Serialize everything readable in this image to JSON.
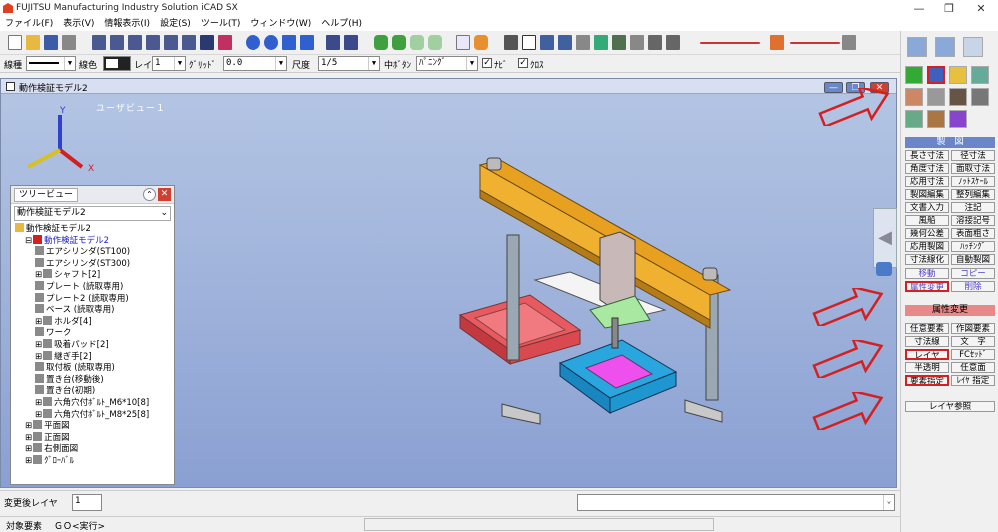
{
  "app": {
    "title": "FUJITSU Manufacturing Industry Solution iCAD SX"
  },
  "window_controls": {
    "minimize": "—",
    "restore": "❐",
    "close": "✕"
  },
  "menu": [
    "ファイル(F)",
    "表示(V)",
    "情報表示(I)",
    "設定(S)",
    "ツール(T)",
    "ウィンドウ(W)",
    "ヘルプ(H)"
  ],
  "toolbar2": {
    "line_type_label": "線種",
    "line_color_label": "線色",
    "layer_label": "レイヤ",
    "layer_value": "1",
    "grid_label": "ｸﾞﾘｯﾄﾞ",
    "grid_value": "0.0",
    "scale_label": "尺度",
    "scale_value": "1/5",
    "center_btn_label": "中ﾎﾞﾀﾝ",
    "center_btn_value": "ﾊﾟﾆﾝｸﾞ",
    "check1_label": "ﾅﾋﾞ",
    "check2_label": "ｸﾛｽ",
    "check1_mark": "✓",
    "check2_mark": "✓"
  },
  "viewport": {
    "title": "動作検証モデル2",
    "view_label": "ユーザビュー１",
    "axis_x": "X",
    "axis_y": "Y"
  },
  "tree": {
    "tab": "ツリービュー",
    "select": "動作検証モデル2",
    "items": [
      {
        "label": "動作検証モデル2",
        "level": 0,
        "exp": ""
      },
      {
        "label": "動作検証モデル2",
        "level": 1,
        "exp": "⊟",
        "red": true
      },
      {
        "label": "エアシリンダ(ST100)",
        "level": 2,
        "exp": ""
      },
      {
        "label": "エアシリンダ(ST300)",
        "level": 2,
        "exp": ""
      },
      {
        "label": "シャフト[2]",
        "level": 2,
        "exp": "⊞"
      },
      {
        "label": "プレート (読取専用)",
        "level": 2,
        "exp": ""
      },
      {
        "label": "プレート2 (読取専用)",
        "level": 2,
        "exp": ""
      },
      {
        "label": "ベース (読取専用)",
        "level": 2,
        "exp": ""
      },
      {
        "label": "ホルダ[4]",
        "level": 2,
        "exp": "⊞"
      },
      {
        "label": "ワーク",
        "level": 2,
        "exp": ""
      },
      {
        "label": "吸着パッド[2]",
        "level": 2,
        "exp": "⊞"
      },
      {
        "label": "継ぎ手[2]",
        "level": 2,
        "exp": "⊞"
      },
      {
        "label": "取付板 (読取専用)",
        "level": 2,
        "exp": ""
      },
      {
        "label": "置き台(移動後)",
        "level": 2,
        "exp": ""
      },
      {
        "label": "置き台(初期)",
        "level": 2,
        "exp": ""
      },
      {
        "label": "六角穴付ﾎﾞﾙﾄ_M6*10[8]",
        "level": 2,
        "exp": "⊞"
      },
      {
        "label": "六角穴付ﾎﾞﾙﾄ_M8*25[8]",
        "level": 2,
        "exp": "⊞"
      },
      {
        "label": "平面図",
        "level": 1,
        "exp": "⊞"
      },
      {
        "label": "正面図",
        "level": 1,
        "exp": "⊞"
      },
      {
        "label": "右側面図",
        "level": 1,
        "exp": "⊞"
      },
      {
        "label": "ｸﾞﾛｰﾊﾞﾙ",
        "level": 1,
        "exp": "⊞"
      }
    ]
  },
  "status": {
    "layer_label": "変更後レイヤ",
    "layer_value": "1",
    "object_label": "対象要素",
    "object_value": "ＧＯ<実行>"
  },
  "panel": {
    "section1": "製　図",
    "buttons": [
      [
        "長さ寸法",
        "径寸法"
      ],
      [
        "角度寸法",
        "面取寸法"
      ],
      [
        "応用寸法",
        "ﾉｯﾄｽｹｰﾙ"
      ],
      [
        "製図編集",
        "整列編集"
      ],
      [
        "文書入力",
        "注記"
      ],
      [
        "風船",
        "溶接記号"
      ],
      [
        "幾何公差",
        "表面粗さ"
      ],
      [
        "応用製図",
        "ﾊｯﾁﾝｸﾞ"
      ],
      [
        "寸法線化",
        "自動製図"
      ]
    ],
    "move": "移動",
    "copy": "コピー",
    "attr_change": "属性変更",
    "delete": "削除",
    "section2": "属性変更",
    "buttons2": [
      [
        "任意要素",
        "作図要素"
      ],
      [
        "寸法線",
        "文　字"
      ],
      [
        "レイヤ",
        "FCｾｯﾄﾞ"
      ],
      [
        "半透明",
        "任意面"
      ],
      [
        "要素指定",
        "ﾚｲﾔ 指定"
      ]
    ],
    "layer_ref": "レイヤ参照"
  },
  "colors": {
    "accent_red": "#d42020",
    "panel_header": "#6a86c8",
    "panel_header2": "#e88888"
  }
}
